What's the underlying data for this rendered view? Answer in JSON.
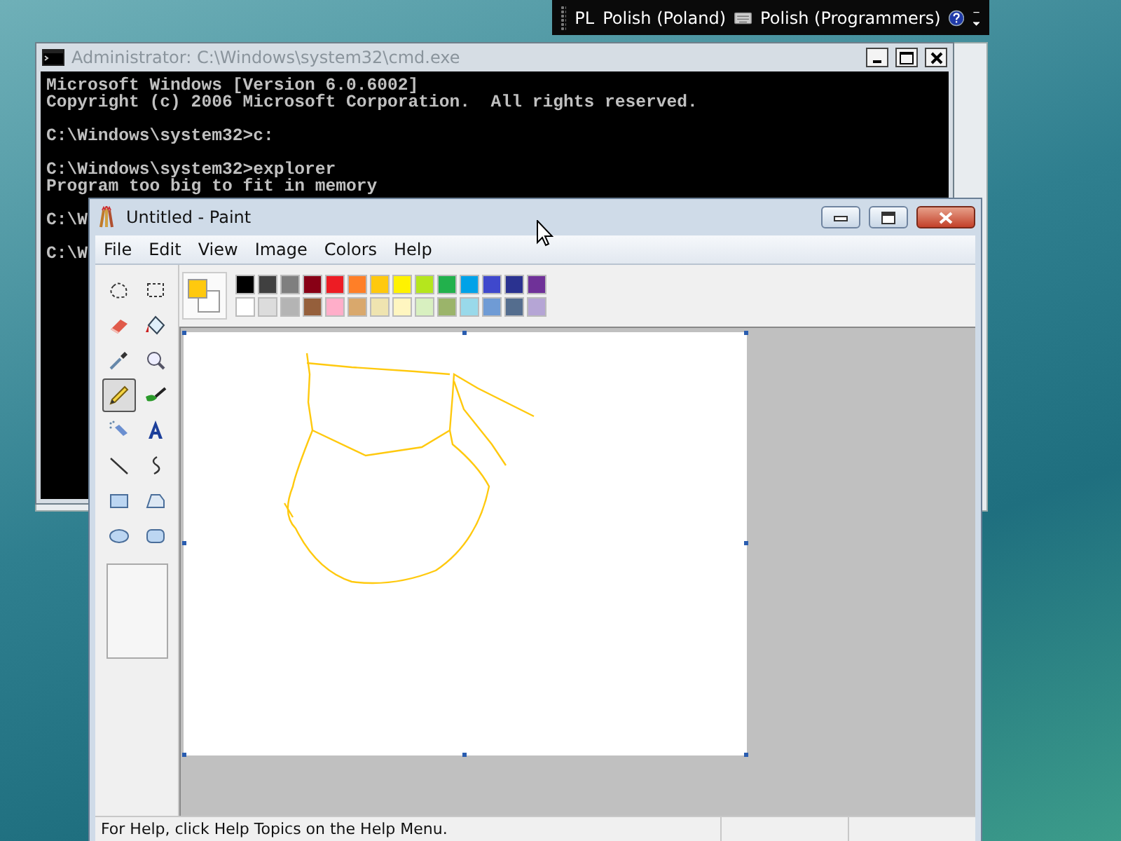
{
  "language_bar": {
    "language_code": "PL",
    "language": "Polish (Poland)",
    "keyboard_layout": "Polish (Programmers)"
  },
  "console_window": {
    "title": "Administrator: C:\\Windows\\system32\\cmd.exe",
    "blocks": [
      [
        "Microsoft Windows [Version 6.0.6002]",
        "Copyright (c) 2006 Microsoft Corporation.  All rights reserved."
      ],
      [
        "C:\\Windows\\system32>c:"
      ],
      [
        "C:\\Windows\\system32>explorer",
        "Program too big to fit in memory"
      ],
      [
        "C:\\W"
      ],
      [
        "C:\\W"
      ]
    ]
  },
  "paint_window": {
    "title": "Untitled - Paint",
    "menu": [
      "File",
      "Edit",
      "View",
      "Image",
      "Colors",
      "Help"
    ],
    "tools": [
      {
        "kind": "free-select",
        "selected": false
      },
      {
        "kind": "select",
        "selected": false
      },
      {
        "kind": "eraser",
        "selected": false
      },
      {
        "kind": "fill",
        "selected": false
      },
      {
        "kind": "picker",
        "selected": false
      },
      {
        "kind": "magnifier",
        "selected": false
      },
      {
        "kind": "pencil",
        "selected": true
      },
      {
        "kind": "brush",
        "selected": false
      },
      {
        "kind": "airbrush",
        "selected": false
      },
      {
        "kind": "text",
        "selected": false
      },
      {
        "kind": "line",
        "selected": false
      },
      {
        "kind": "curve",
        "selected": false
      },
      {
        "kind": "rectangle",
        "selected": false
      },
      {
        "kind": "polygon",
        "selected": false
      },
      {
        "kind": "ellipse",
        "selected": false
      },
      {
        "kind": "rounded-rectangle",
        "selected": false
      }
    ],
    "current_colors": {
      "foreground": {
        "color": "#ffc90e"
      },
      "background": {
        "color": "#ffffff"
      }
    },
    "palette": [
      {
        "color": "#000000"
      },
      {
        "color": "#404040"
      },
      {
        "color": "#7f7f7f"
      },
      {
        "color": "#880015"
      },
      {
        "color": "#ed1c24"
      },
      {
        "color": "#ff7f27"
      },
      {
        "color": "#ffc90e"
      },
      {
        "color": "#fff200"
      },
      {
        "color": "#b5e61d"
      },
      {
        "color": "#22b14c"
      },
      {
        "color": "#00a2e8"
      },
      {
        "color": "#3f48cc"
      },
      {
        "color": "#2a3290"
      },
      {
        "color": "#6f3198"
      },
      {
        "color": "#ffffff"
      },
      {
        "color": "#dcdcdc"
      },
      {
        "color": "#b4b4b4"
      },
      {
        "color": "#955f3b"
      },
      {
        "color": "#ffaec9"
      },
      {
        "color": "#d9a86c"
      },
      {
        "color": "#efe4b0"
      },
      {
        "color": "#fff6c0"
      },
      {
        "color": "#d8f0c0"
      },
      {
        "color": "#9bb46a"
      },
      {
        "color": "#99d9ea"
      },
      {
        "color": "#6f9bd5"
      },
      {
        "color": "#546d8e"
      },
      {
        "color": "#b5a5d5"
      }
    ],
    "status_bar": "For Help, click Help Topics on the Help Menu."
  }
}
